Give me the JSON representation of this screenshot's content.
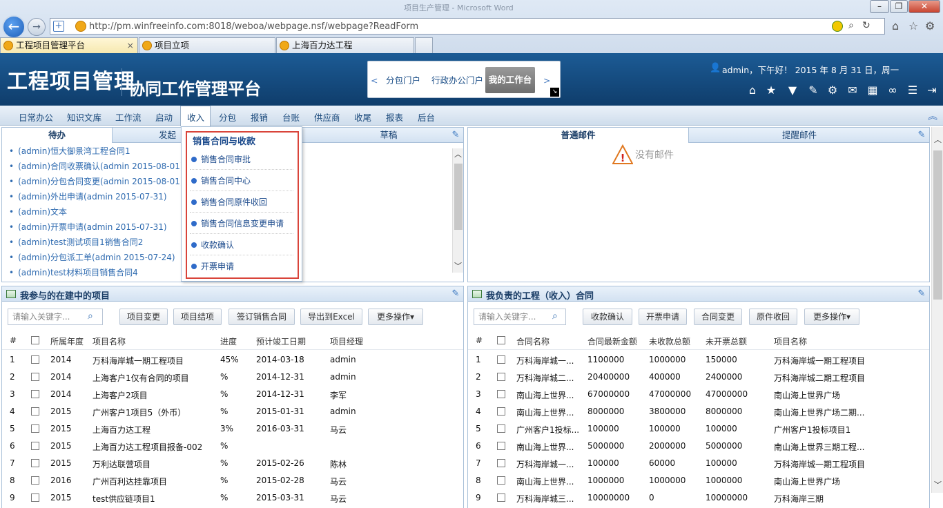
{
  "browser": {
    "window_title": "项目生产管理 - Microsoft Word",
    "url": "http://pm.winfreeinfo.com:8018/weboa/webpage.nsf/webpage?ReadForm",
    "tabs": [
      {
        "label": "工程项目管理平台",
        "close": "×"
      },
      {
        "label": "项目立项"
      },
      {
        "label": "上海百力达工程"
      }
    ]
  },
  "header": {
    "logo_main": "工程项目管理",
    "logo_sub": "协同工作管理平台",
    "portal": {
      "prev": "<",
      "next": ">",
      "items": [
        "分包门户",
        "行政办公门户"
      ],
      "active": "我的工作台"
    },
    "greeting": "admin，下午好！ 2015 年 8 月 31 日，周一",
    "icons": [
      "home-icon",
      "star-icon",
      "shirt-icon",
      "edit-icon",
      "gear-icon",
      "mail-icon",
      "calendar-icon",
      "binoculars-icon",
      "list-icon",
      "logout-icon"
    ]
  },
  "menu": {
    "items": [
      "日常办公",
      "知识文库",
      "工作流",
      "启动",
      "收入",
      "分包",
      "报销",
      "台账",
      "供应商",
      "收尾",
      "报表",
      "后台"
    ],
    "active": "收入"
  },
  "todo_panel": {
    "tabs": [
      "待办",
      "发起",
      "",
      "草稿"
    ],
    "items": [
      "(admin)恒大御景湾工程合同1",
      "(admin)合同收票确认(admin 2015-08-01)",
      "(admin)分包合同变更(admin 2015-08-01)",
      "(admin)外出申请(admin 2015-07-31)",
      "(admin)文本",
      "(admin)开票申请(admin 2015-07-31)",
      "(admin)test测试项目1销售合同2",
      "(admin)分包派工单(admin 2015-07-24)",
      "(admin)test材料项目销售合同4"
    ]
  },
  "dropdown": {
    "title": "销售合同与收款",
    "items": [
      "销售合同审批",
      "销售合同中心",
      "销售合同原件收回",
      "销售合同信息变更申请",
      "收款确认",
      "开票申请"
    ]
  },
  "mail_panel": {
    "tabs": [
      "普通邮件",
      "提醒邮件"
    ],
    "empty_text": "没有邮件"
  },
  "projects": {
    "title": "我参与的在建中的项目",
    "search_placeholder": "请输入关键字...",
    "buttons": [
      "项目变更",
      "项目结项",
      "签订销售合同",
      "导出到Excel",
      "更多操作▾"
    ],
    "columns": [
      "#",
      "",
      "所属年度",
      "项目名称",
      "进度",
      "预计竣工日期",
      "项目经理"
    ],
    "rows": [
      [
        "1",
        "2014",
        "万科海岸城一期工程项目",
        "45%",
        "2014-03-18",
        "admin"
      ],
      [
        "2",
        "2014",
        "上海客户1仅有合同的项目",
        "%",
        "2014-12-31",
        "admin"
      ],
      [
        "3",
        "2014",
        "上海客户2项目",
        "%",
        "2014-12-31",
        "李军"
      ],
      [
        "4",
        "2015",
        "广州客户1项目5（外币）",
        "%",
        "2015-01-31",
        "admin"
      ],
      [
        "5",
        "2015",
        "上海百力达工程",
        "3%",
        "2016-03-31",
        "马云"
      ],
      [
        "6",
        "2015",
        "上海百力达工程项目报备-002",
        "%",
        "",
        ""
      ],
      [
        "7",
        "2015",
        "万利达联营项目",
        "%",
        "2015-02-26",
        "陈林"
      ],
      [
        "8",
        "2016",
        "广州百利达挂靠项目",
        "%",
        "2015-02-28",
        "马云"
      ],
      [
        "9",
        "2015",
        "test供应链项目1",
        "%",
        "2015-03-31",
        "马云"
      ]
    ]
  },
  "contracts": {
    "title": "我负责的工程（收入）合同",
    "search_placeholder": "请输入关键字...",
    "buttons": [
      "收款确认",
      "开票申请",
      "合同变更",
      "原件收回",
      "更多操作▾"
    ],
    "columns": [
      "#",
      "",
      "合同名称",
      "合同最新金额",
      "未收款总额",
      "未开票总额",
      "项目名称"
    ],
    "rows": [
      [
        "1",
        "万科海岸城一...",
        "1100000",
        "1000000",
        "150000",
        "万科海岸城一期工程项目"
      ],
      [
        "2",
        "万科海岸城二...",
        "20400000",
        "400000",
        "2400000",
        "万科海岸城二期工程项目"
      ],
      [
        "3",
        "南山海上世界...",
        "67000000",
        "47000000",
        "47000000",
        "南山海上世界广场"
      ],
      [
        "4",
        "南山海上世界...",
        "8000000",
        "3800000",
        "8000000",
        "南山海上世界广场二期..."
      ],
      [
        "5",
        "广州客户1投标...",
        "100000",
        "100000",
        "100000",
        "广州客户1投标项目1"
      ],
      [
        "6",
        "南山海上世界...",
        "5000000",
        "2000000",
        "5000000",
        "南山海上世界三期工程..."
      ],
      [
        "7",
        "万科海岸城一...",
        "100000",
        "60000",
        "100000",
        "万科海岸城一期工程项目"
      ],
      [
        "8",
        "南山海上世界...",
        "1000000",
        "1000000",
        "1000000",
        "南山海上世界广场"
      ],
      [
        "9",
        "万科海岸城三...",
        "10000000",
        "0",
        "10000000",
        "万科海岸三期"
      ]
    ]
  }
}
